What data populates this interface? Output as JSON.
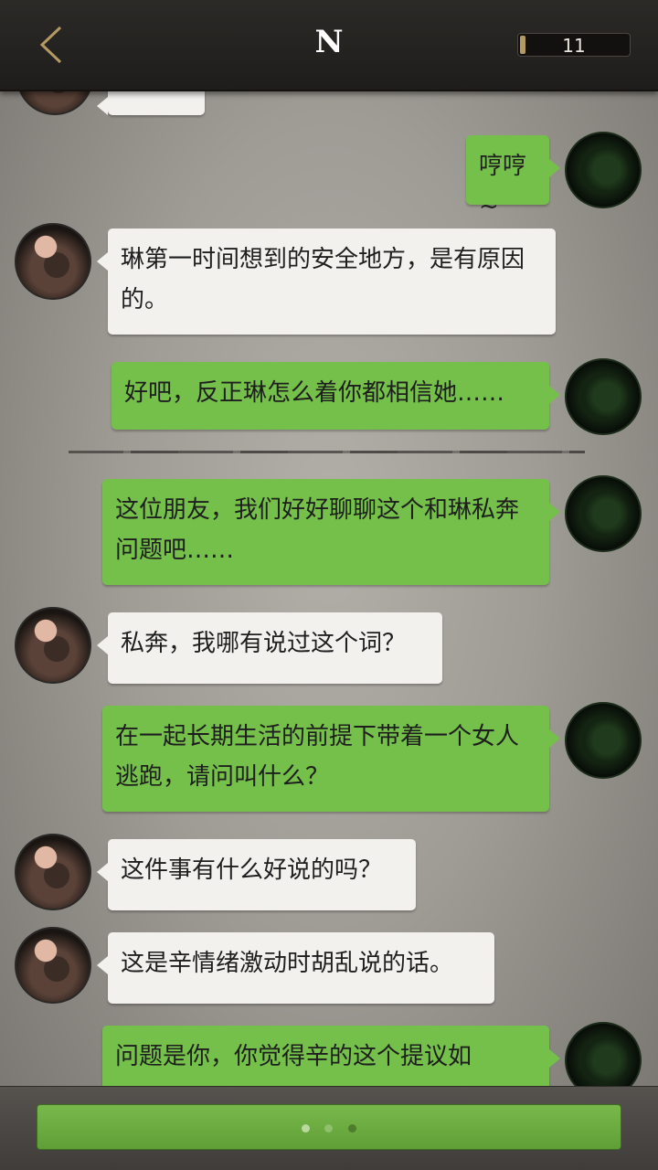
{
  "header": {
    "title": "N",
    "counter": "11",
    "counter_fill_fraction": 0.05
  },
  "messages": [
    {
      "sender": "npc",
      "text": ""
    },
    {
      "sender": "me",
      "text": "哼哼~"
    },
    {
      "sender": "npc",
      "text": "琳第一时间想到的安全地方，是有原因的。"
    },
    {
      "sender": "me",
      "text": "好吧，反正琳怎么着你都相信她……"
    },
    {
      "sender": "me",
      "text": "这位朋友，我们好好聊聊这个和琳私奔问题吧……"
    },
    {
      "sender": "npc",
      "text": "私奔，我哪有说过这个词？"
    },
    {
      "sender": "me",
      "text": "在一起长期生活的前提下带着一个女人逃跑，请问叫什么？"
    },
    {
      "sender": "npc",
      "text": "这件事有什么好说的吗？"
    },
    {
      "sender": "npc",
      "text": "这是辛情绪激动时胡乱说的话。"
    },
    {
      "sender": "me",
      "text": "问题是你，你觉得辛的这个提议如"
    }
  ],
  "footer": {
    "dots": 3
  },
  "colors": {
    "me_bubble": "#74c04a",
    "npc_bubble": "#f2f1ee",
    "header": "#24221f",
    "accent_gold": "#b39a63"
  },
  "icons": {
    "back": "chevron-left-icon"
  }
}
